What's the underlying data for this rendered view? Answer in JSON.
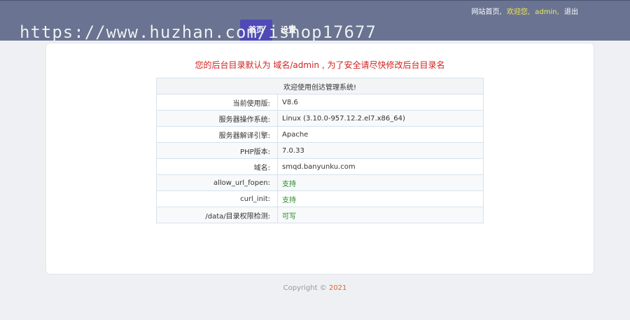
{
  "header": {
    "links": {
      "home": "网站首页,",
      "welcome": "欢迎您,",
      "user": "admin,",
      "logout": "退出"
    },
    "nav": {
      "home": "首页",
      "settings": "设置"
    }
  },
  "watermark": "https://www.huzhan.com/ishop17677",
  "main": {
    "warning": "您的后台目录默认为 域名/admin , 为了安全请尽快修改后台目录名",
    "table": {
      "title": "欢迎使用创达管理系统!",
      "rows": [
        {
          "key": "当前使用版:",
          "value": "V8.6"
        },
        {
          "key": "服务器操作系统:",
          "value": "Linux (3.10.0-957.12.2.el7.x86_64)"
        },
        {
          "key": "服务器解译引擎:",
          "value": "Apache"
        },
        {
          "key": "PHP版本:",
          "value": "7.0.33"
        },
        {
          "key": "域名:",
          "value": "smqd.banyunku.com"
        },
        {
          "key": "allow_url_fopen:",
          "value": "支持"
        },
        {
          "key": "curl_init:",
          "value": "支持"
        },
        {
          "key": "/data/目录权限检测:",
          "value": "可写"
        }
      ]
    }
  },
  "footer": {
    "copyright": "Copyright ©",
    "year": "2021"
  },
  "colors": {
    "topbar": "#6a7492",
    "active_tab": "#4f4ab7",
    "warning": "#d0231f",
    "ok": "#2a8a2a",
    "year": "#e0682a"
  }
}
